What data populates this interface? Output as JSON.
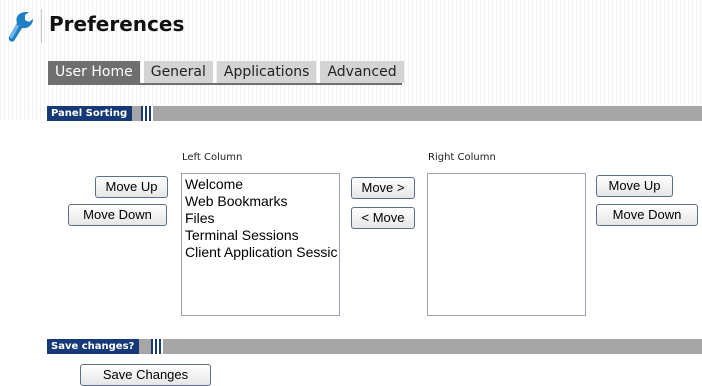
{
  "header": {
    "title": "Preferences",
    "logo_icon": "wrench-icon"
  },
  "tabs": [
    {
      "label": "User Home",
      "active": true
    },
    {
      "label": "General",
      "active": false
    },
    {
      "label": "Applications",
      "active": false
    },
    {
      "label": "Advanced",
      "active": false
    }
  ],
  "panel_sorting": {
    "section_label": "Panel Sorting",
    "left_column_label": "Left Column",
    "right_column_label": "Right Column",
    "left_items": [
      "Welcome",
      "Web Bookmarks",
      "Files",
      "Terminal Sessions",
      "Client Application Sessic"
    ],
    "right_items": [],
    "left_move_up": "Move Up",
    "left_move_down": "Move Down",
    "move_right": "Move >",
    "move_left": "< Move",
    "right_move_up": "Move Up",
    "right_move_down": "Move Down"
  },
  "save_section": {
    "section_label": "Save changes?",
    "save_button": "Save Changes"
  },
  "colors": {
    "section_blue": "#163a78",
    "section_gray": "#a6a6a6",
    "active_tab": "#6f6f6f",
    "inactive_tab": "#d4d4d4"
  }
}
